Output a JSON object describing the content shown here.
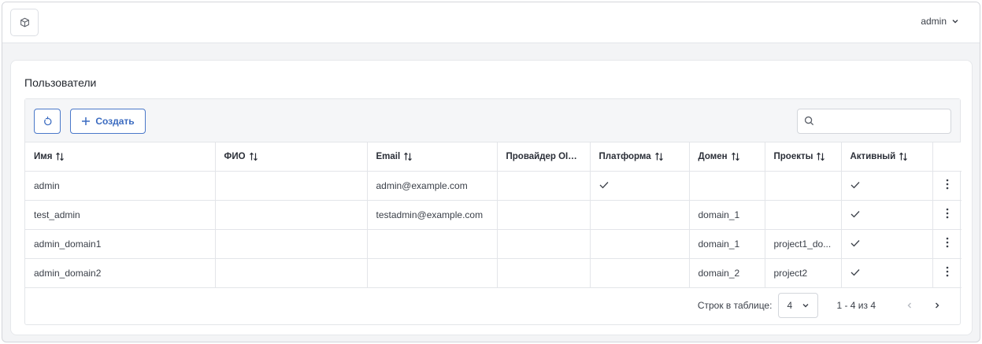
{
  "header": {
    "logo_icon": "cube-icon",
    "user_name": "admin"
  },
  "page": {
    "title": "Пользователи"
  },
  "toolbar": {
    "refresh_icon": "refresh-icon",
    "create_label": "Создать",
    "search_placeholder": "",
    "accent_color": "#3b6bc0"
  },
  "table": {
    "columns": [
      {
        "label": "Имя",
        "sortable": true
      },
      {
        "label": "ФИО",
        "sortable": true
      },
      {
        "label": "Email",
        "sortable": true
      },
      {
        "label": "Провайдер OIDC",
        "sortable": false
      },
      {
        "label": "Платформа",
        "sortable": true
      },
      {
        "label": "Домен",
        "sortable": true
      },
      {
        "label": "Проекты",
        "sortable": true
      },
      {
        "label": "Активный",
        "sortable": true
      },
      {
        "label": "",
        "sortable": false
      }
    ],
    "rows": [
      {
        "name": "admin",
        "fio": "",
        "email": "admin@example.com",
        "oidc": "",
        "platform": true,
        "domain": "",
        "projects": "",
        "active": true
      },
      {
        "name": "test_admin",
        "fio": "",
        "email": "testadmin@example.com",
        "oidc": "",
        "platform": false,
        "domain": "domain_1",
        "projects": "",
        "active": true
      },
      {
        "name": "admin_domain1",
        "fio": "",
        "email": "",
        "oidc": "",
        "platform": false,
        "domain": "domain_1",
        "projects": "project1_do...",
        "active": true
      },
      {
        "name": "admin_domain2",
        "fio": "",
        "email": "",
        "oidc": "",
        "platform": false,
        "domain": "domain_2",
        "projects": "project2",
        "active": true
      }
    ]
  },
  "pagination": {
    "rows_per_page_label": "Строк в таблице:",
    "rows_per_page_value": "4",
    "range_text": "1 - 4 из 4"
  }
}
